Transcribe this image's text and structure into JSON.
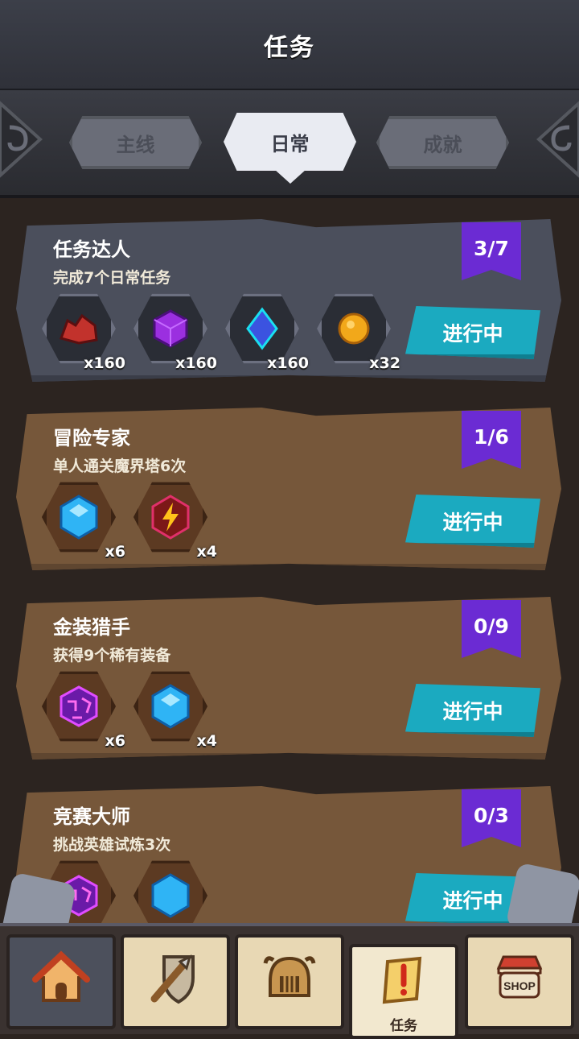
{
  "header": {
    "title": "任务"
  },
  "tabs": [
    {
      "label": "主线",
      "active": false
    },
    {
      "label": "日常",
      "active": true
    },
    {
      "label": "成就",
      "active": false
    }
  ],
  "quests": [
    {
      "name": "任务达人",
      "desc": "完成7个日常任务",
      "progress": "3/7",
      "button": "进行中",
      "theme": "grey",
      "rewards": [
        {
          "icon": "red-ore-icon",
          "qty": "x160"
        },
        {
          "icon": "purple-cube-icon",
          "qty": "x160"
        },
        {
          "icon": "blue-crystal-icon",
          "qty": "x160"
        },
        {
          "icon": "gold-coin-icon",
          "qty": "x32"
        }
      ]
    },
    {
      "name": "冒险专家",
      "desc": "单人通关魔界塔6次",
      "progress": "1/6",
      "button": "进行中",
      "theme": "brown",
      "rewards": [
        {
          "icon": "blue-gem-icon",
          "qty": "x6"
        },
        {
          "icon": "energy-bolt-icon",
          "qty": "x4"
        }
      ]
    },
    {
      "name": "金装猎手",
      "desc": "获得9个稀有装备",
      "progress": "0/9",
      "button": "进行中",
      "theme": "brown",
      "rewards": [
        {
          "icon": "rune-cube-icon",
          "qty": "x6"
        },
        {
          "icon": "blue-gem-icon",
          "qty": "x4"
        }
      ]
    },
    {
      "name": "竞赛大师",
      "desc": "挑战英雄试炼3次",
      "progress": "0/3",
      "button": "进行中",
      "theme": "brown",
      "rewards": [
        {
          "icon": "rune-cube-icon",
          "qty": ""
        },
        {
          "icon": "blue-gem-icon",
          "qty": ""
        }
      ]
    }
  ],
  "nav": [
    {
      "icon": "home-icon",
      "label": ""
    },
    {
      "icon": "sword-shield-icon",
      "label": ""
    },
    {
      "icon": "helmet-icon",
      "label": ""
    },
    {
      "icon": "quest-scroll-icon",
      "label": "任务"
    },
    {
      "icon": "shop-icon",
      "label": "SHOP"
    }
  ]
}
